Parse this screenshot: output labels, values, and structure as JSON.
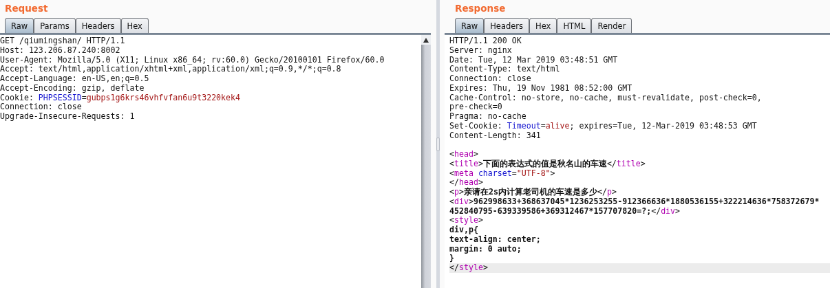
{
  "request": {
    "title": "Request",
    "tabs": [
      {
        "label": "Raw",
        "selected": true
      },
      {
        "label": "Params",
        "selected": false
      },
      {
        "label": "Headers",
        "selected": false
      },
      {
        "label": "Hex",
        "selected": false
      }
    ],
    "lines": [
      {
        "segments": [
          {
            "text": "GET /qiumingshan/ HTTP/1.1",
            "kind": "text"
          }
        ]
      },
      {
        "segments": [
          {
            "text": "Host: 123.206.87.240:8002",
            "kind": "text"
          }
        ]
      },
      {
        "segments": [
          {
            "text": "User-Agent: Mozilla/5.0 (X11; Linux x86_64; rv:60.0) Gecko/20100101 Firefox/60.0",
            "kind": "text"
          }
        ]
      },
      {
        "segments": [
          {
            "text": "Accept: text/html,application/xhtml+xml,application/xml;q=0.9,*/*;q=0.8",
            "kind": "text"
          }
        ]
      },
      {
        "segments": [
          {
            "text": "Accept-Language: en-US,en;q=0.5",
            "kind": "text"
          }
        ]
      },
      {
        "segments": [
          {
            "text": "Accept-Encoding: gzip, deflate",
            "kind": "text"
          }
        ]
      },
      {
        "segments": [
          {
            "text": "Cookie: ",
            "kind": "text"
          },
          {
            "text": "PHPSESSID",
            "kind": "name"
          },
          {
            "text": "=",
            "kind": "text"
          },
          {
            "text": "gubps1g6krs46vhfvfan6u9t3220kek4",
            "kind": "value"
          }
        ]
      },
      {
        "segments": [
          {
            "text": "Connection: close",
            "kind": "text"
          }
        ]
      },
      {
        "segments": [
          {
            "text": "Upgrade-Insecure-Requests: 1",
            "kind": "text"
          }
        ]
      }
    ]
  },
  "response": {
    "title": "Response",
    "tabs": [
      {
        "label": "Raw",
        "selected": true
      },
      {
        "label": "Headers",
        "selected": false
      },
      {
        "label": "Hex",
        "selected": false
      },
      {
        "label": "HTML",
        "selected": false
      },
      {
        "label": "Render",
        "selected": false
      }
    ],
    "lines": [
      {
        "segments": [
          {
            "text": "HTTP/1.1 200 OK",
            "kind": "text"
          }
        ]
      },
      {
        "segments": [
          {
            "text": "Server: nginx",
            "kind": "text"
          }
        ]
      },
      {
        "segments": [
          {
            "text": "Date: Tue, 12 Mar 2019 03:48:51 GMT",
            "kind": "text"
          }
        ]
      },
      {
        "segments": [
          {
            "text": "Content-Type: text/html",
            "kind": "text"
          }
        ]
      },
      {
        "segments": [
          {
            "text": "Connection: close",
            "kind": "text"
          }
        ]
      },
      {
        "segments": [
          {
            "text": "Expires: Thu, 19 Nov 1981 08:52:00 GMT",
            "kind": "text"
          }
        ]
      },
      {
        "segments": [
          {
            "text": "Cache-Control: no-store, no-cache, must-revalidate, post-check=0,",
            "kind": "text"
          }
        ]
      },
      {
        "segments": [
          {
            "text": "pre-check=0",
            "kind": "text"
          }
        ]
      },
      {
        "segments": [
          {
            "text": "Pragma: no-cache",
            "kind": "text"
          }
        ]
      },
      {
        "segments": [
          {
            "text": "Set-Cookie: ",
            "kind": "text"
          },
          {
            "text": "Timeout",
            "kind": "name"
          },
          {
            "text": "=",
            "kind": "text"
          },
          {
            "text": "alive",
            "kind": "value"
          },
          {
            "text": "; expires=Tue, 12-Mar-2019 03:48:53 GMT",
            "kind": "text"
          }
        ]
      },
      {
        "segments": [
          {
            "text": "Content-Length: 341",
            "kind": "text"
          }
        ]
      }
    ],
    "body_lines": [
      {
        "segments": [
          {
            "text": "<",
            "kind": "text"
          },
          {
            "text": "head",
            "kind": "tag"
          },
          {
            "text": ">",
            "kind": "text"
          }
        ]
      },
      {
        "segments": [
          {
            "text": "<",
            "kind": "text"
          },
          {
            "text": "title",
            "kind": "tag"
          },
          {
            "text": ">",
            "kind": "text"
          },
          {
            "text": "下面的表达式的值是秋名山的车速",
            "kind": "bold"
          },
          {
            "text": "</",
            "kind": "text"
          },
          {
            "text": "title",
            "kind": "tag"
          },
          {
            "text": ">",
            "kind": "text"
          }
        ]
      },
      {
        "segments": [
          {
            "text": "<",
            "kind": "text"
          },
          {
            "text": "meta",
            "kind": "tag"
          },
          {
            "text": " charset",
            "kind": "name"
          },
          {
            "text": "=",
            "kind": "text"
          },
          {
            "text": "\"UTF-8\"",
            "kind": "value"
          },
          {
            "text": ">",
            "kind": "text"
          }
        ]
      },
      {
        "segments": [
          {
            "text": "</",
            "kind": "text"
          },
          {
            "text": "head",
            "kind": "tag"
          },
          {
            "text": ">",
            "kind": "text"
          }
        ]
      },
      {
        "segments": [
          {
            "text": "<",
            "kind": "text"
          },
          {
            "text": "p",
            "kind": "tag"
          },
          {
            "text": ">",
            "kind": "text"
          },
          {
            "text": "亲请在2s内计算老司机的车速是多少",
            "kind": "bold"
          },
          {
            "text": "</",
            "kind": "text"
          },
          {
            "text": "p",
            "kind": "tag"
          },
          {
            "text": ">",
            "kind": "text"
          }
        ]
      },
      {
        "segments": [
          {
            "text": "<",
            "kind": "text"
          },
          {
            "text": "div",
            "kind": "tag"
          },
          {
            "text": ">",
            "kind": "text"
          },
          {
            "text": "962998633+368637045*1236253255-912366636*1880536155+322214636*758372679*",
            "kind": "bold"
          }
        ]
      },
      {
        "segments": [
          {
            "text": "452840795-639339586+369312467*157707820=?;",
            "kind": "bold"
          },
          {
            "text": "</",
            "kind": "text"
          },
          {
            "text": "div",
            "kind": "tag"
          },
          {
            "text": ">",
            "kind": "text"
          }
        ]
      },
      {
        "segments": [
          {
            "text": "<",
            "kind": "text"
          },
          {
            "text": "style",
            "kind": "tag"
          },
          {
            "text": ">",
            "kind": "text"
          }
        ]
      },
      {
        "segments": [
          {
            "text": "div,p{",
            "kind": "bold"
          }
        ]
      },
      {
        "segments": [
          {
            "text": "text-align: center;",
            "kind": "bold"
          }
        ]
      },
      {
        "segments": [
          {
            "text": "margin: 0 auto;",
            "kind": "bold"
          }
        ]
      },
      {
        "segments": [
          {
            "text": "}",
            "kind": "bold"
          }
        ]
      },
      {
        "highlighted": true,
        "segments": [
          {
            "text": "</",
            "kind": "text"
          },
          {
            "text": "style",
            "kind": "tag"
          },
          {
            "text": ">",
            "kind": "text"
          }
        ]
      }
    ]
  }
}
